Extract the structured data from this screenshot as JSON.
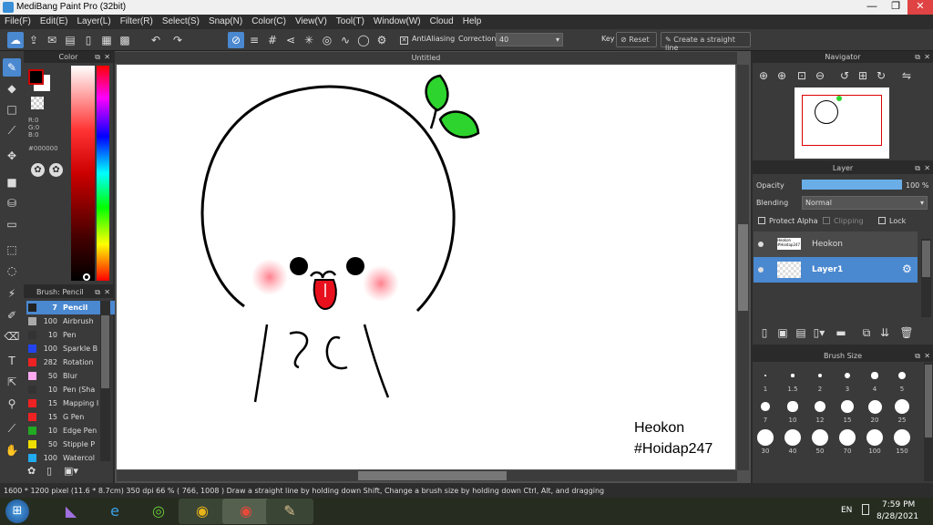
{
  "window": {
    "title": "MediBang Paint Pro (32bit)",
    "minimize": "—",
    "maximize": "❐",
    "close": "✕"
  },
  "menu": [
    "File(F)",
    "Edit(E)",
    "Layer(L)",
    "Filter(R)",
    "Select(S)",
    "Snap(N)",
    "Color(C)",
    "View(V)",
    "Tool(T)",
    "Window(W)",
    "Cloud",
    "Help"
  ],
  "toolbar": {
    "antialiasing_label": "AntiAliasing",
    "correction_label": "Correction",
    "correction_value": "40",
    "key_label": "Key",
    "reset_label": "Reset",
    "straight_line_label": "Create a straight line"
  },
  "color_panel": {
    "title": "Color",
    "r": "R:0",
    "g": "G:0",
    "b": "B:0",
    "hex": "#000000",
    "fg_color": "#000000",
    "bg_color": "#ffffff"
  },
  "document": {
    "tab_title": "Untitled",
    "caption_line1": "Heokon",
    "caption_line2": "#Hoidap247"
  },
  "brush_panel": {
    "title": "Brush: Pencil",
    "items": [
      {
        "size": "7",
        "name": "Pencil",
        "color": "#222222"
      },
      {
        "size": "100",
        "name": "Airbrush",
        "color": "#aaaaaa"
      },
      {
        "size": "10",
        "name": "Pen",
        "color": "#333333"
      },
      {
        "size": "100",
        "name": "Sparkle B",
        "color": "#2244ee"
      },
      {
        "size": "282",
        "name": "Rotation",
        "color": "#ee2222"
      },
      {
        "size": "50",
        "name": "Blur",
        "color": "#ffaaee"
      },
      {
        "size": "10",
        "name": "Pen (Sha",
        "color": "#333333"
      },
      {
        "size": "15",
        "name": "Mapping I",
        "color": "#ee2222"
      },
      {
        "size": "15",
        "name": "G Pen",
        "color": "#ee2222"
      },
      {
        "size": "10",
        "name": "Edge Pen",
        "color": "#22aa22"
      },
      {
        "size": "50",
        "name": "Stipple P",
        "color": "#eedd00"
      },
      {
        "size": "100",
        "name": "Watercol",
        "color": "#22aaee"
      }
    ]
  },
  "navigator": {
    "title": "Navigator"
  },
  "layer_panel": {
    "title": "Layer",
    "opacity_label": "Opacity",
    "opacity_value": "100 %",
    "opacity_fraction": 1.0,
    "blending_label": "Blending",
    "blending_value": "Normal",
    "protect_alpha": "Protect Alpha",
    "clipping": "Clipping",
    "lock": "Lock",
    "layers": [
      {
        "name": "Heokon",
        "selected": false
      },
      {
        "name": "Layer1",
        "selected": true
      }
    ]
  },
  "brush_size_panel": {
    "title": "Brush Size",
    "sizes": [
      "1",
      "1.5",
      "2",
      "3",
      "4",
      "5",
      "7",
      "10",
      "12",
      "15",
      "20",
      "25",
      "30",
      "40",
      "50",
      "70",
      "100",
      "150"
    ]
  },
  "status": {
    "text": "1600 * 1200 pixel   (11.6 * 8.7cm)   350 dpi   66 %   ( 766, 1008 )   Draw a straight line by holding down Shift, Change a brush size by holding down Ctrl, Alt, and dragging"
  },
  "taskbar": {
    "lang": "EN",
    "time": "7:59 PM",
    "date": "8/28/2021"
  }
}
